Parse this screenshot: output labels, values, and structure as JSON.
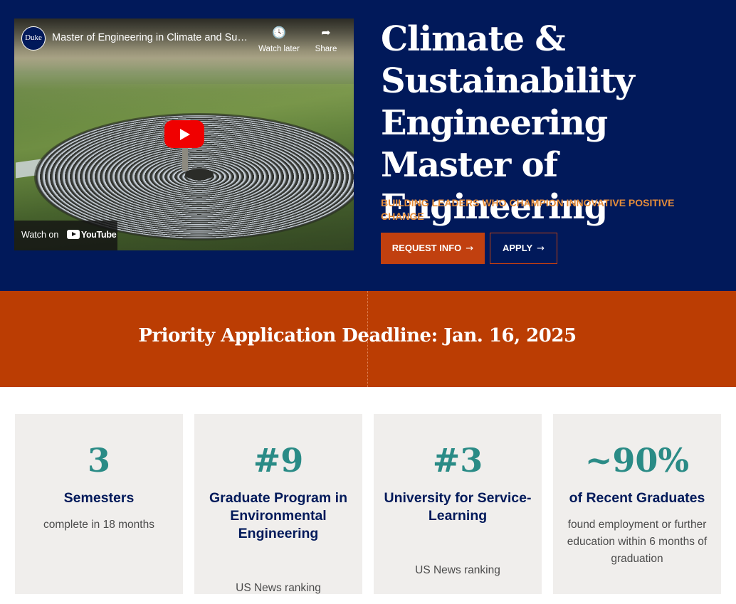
{
  "video": {
    "logo_text": "Duke",
    "title": "Master of Engineering in Climate and Sustainability Engineering",
    "watch_later_label": "Watch later",
    "share_label": "Share",
    "watch_on_label": "Watch on",
    "youtube_label": "YouTube",
    "watch_later_icon": "clock-icon",
    "share_icon": "share-arrow-icon",
    "play_icon": "play-icon",
    "play_color": "#f00000"
  },
  "hero": {
    "title": "Climate & Sustainability Engineering Master of Engineering",
    "subtitle": "Building leaders who champion innovative positive change",
    "request_info_label": "REQUEST INFO",
    "apply_label": "APPLY",
    "arrow_icon": "arrow-right-icon",
    "background_color": "#01195a",
    "accent_color": "#c1400f",
    "subtitle_color": "#e38c3a"
  },
  "deadline": {
    "text": "Priority Application Deadline: Jan. 16, 2025",
    "background_color": "#bb3d03"
  },
  "stats": [
    {
      "value": "3",
      "heading": "Semesters",
      "description": "complete in 18 months"
    },
    {
      "value": "#9",
      "heading": "Graduate Program in Environmental Engineering",
      "description": "US News ranking"
    },
    {
      "value": "#3",
      "heading": "University for Service-Learning",
      "description": "US News ranking"
    },
    {
      "value": "~90%",
      "heading": "of Recent Graduates",
      "description": "found employment or further education within 6 months of graduation"
    }
  ],
  "stat_value_color": "#2a8b86",
  "stat_heading_color": "#01195a"
}
